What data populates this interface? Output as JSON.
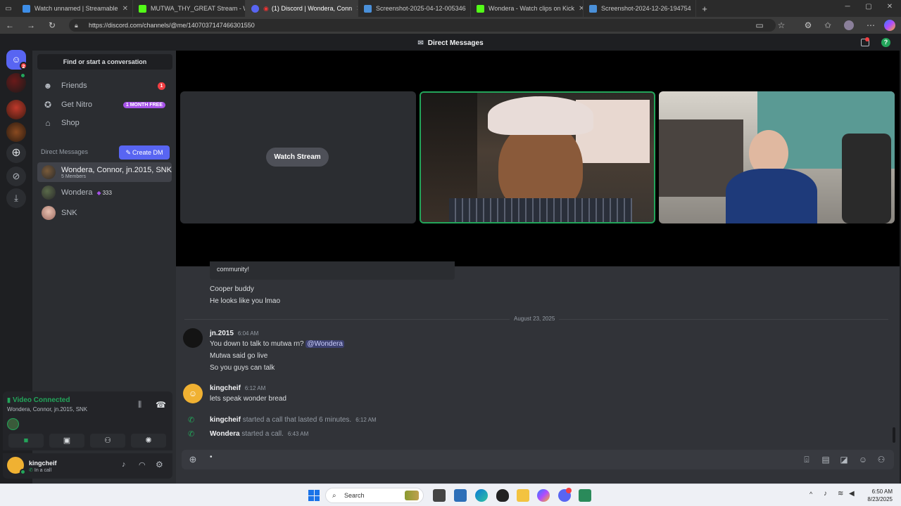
{
  "browser": {
    "tabs": [
      {
        "title": "Watch unnamed | Streamable",
        "active": false
      },
      {
        "title": "MUTWA_THY_GREAT Stream - W",
        "active": false
      },
      {
        "title": "(1) Discord | Wondera, Conn",
        "active": true
      },
      {
        "title": "Screenshot-2025-04-12-005346",
        "active": false
      },
      {
        "title": "Wondera - Watch clips on Kick",
        "active": false
      },
      {
        "title": "Screenshot-2024-12-26-194754",
        "active": false
      }
    ],
    "url": "https://discord.com/channels/@me/1407037147466301550"
  },
  "topbar": {
    "title": "Direct Messages"
  },
  "sidebar": {
    "search_label": "Find or start a conversation",
    "nav": [
      {
        "label": "Friends",
        "badge": "1"
      },
      {
        "label": "Get Nitro",
        "badge": "1 MONTH FREE"
      },
      {
        "label": "Shop",
        "badge": ""
      }
    ],
    "dm_header": "Direct Messages",
    "create_dm": "Create DM",
    "dms": [
      {
        "name": "Wondera, Connor, jn.2015, SNK",
        "sub": "5 Members",
        "badge": ""
      },
      {
        "name": "Wondera",
        "sub": "",
        "badge": "333"
      },
      {
        "name": "SNK",
        "sub": "",
        "badge": ""
      }
    ],
    "server_badge": "2"
  },
  "voice": {
    "status": "Video Connected",
    "channel": "Wondera, Connor, jn.2015, SNK"
  },
  "user": {
    "name": "kingcheif",
    "status": "In a call"
  },
  "call": {
    "watch_stream": "Watch Stream"
  },
  "messages": {
    "embed_tail": "community!",
    "early": [
      "Cooper buddy",
      "He looks like you lmao"
    ],
    "date_divider": "August 23, 2025",
    "groups": [
      {
        "author": "jn.2015",
        "time": "6:04 AM",
        "lines": [
          "You down to talk to mutwa rn?",
          "Mutwa said go live",
          "So you guys can talk"
        ],
        "mention": "@Wondera"
      },
      {
        "author": "kingcheif",
        "time": "6:12 AM",
        "lines": [
          "lets speak wonder bread"
        ],
        "mention": ""
      }
    ],
    "system": [
      {
        "author": "kingcheif",
        "text": "started a call that lasted 6 minutes.",
        "time": "6:12 AM"
      },
      {
        "author": "Wondera",
        "text": "started a call.",
        "time": "6:43 AM"
      }
    ]
  },
  "composer": {
    "value": "•"
  },
  "taskbar": {
    "search": "Search",
    "time": "6:50 AM",
    "date": "8/23/2025"
  },
  "colors": {
    "accent": "#5865f2",
    "green": "#23a55a",
    "nitro": "#a652e8",
    "red": "#f23f43"
  }
}
